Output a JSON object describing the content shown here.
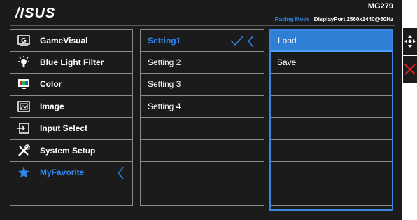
{
  "header": {
    "logo": "ASUS",
    "model": "MG279",
    "mode": "Racing Mode",
    "port_info": "DisplayPort  2560x1440@60Hz"
  },
  "main_menu": [
    {
      "label": "GameVisual",
      "icon": "gamevisual-icon"
    },
    {
      "label": "Blue Light Filter",
      "icon": "bluelight-icon"
    },
    {
      "label": "Color",
      "icon": "color-icon"
    },
    {
      "label": "Image",
      "icon": "image-icon"
    },
    {
      "label": "Input Select",
      "icon": "input-select-icon"
    },
    {
      "label": "System Setup",
      "icon": "system-setup-icon"
    },
    {
      "label": "MyFavorite",
      "icon": "star-icon",
      "active": true
    },
    {
      "label": ""
    }
  ],
  "sub_menu": [
    {
      "label": "Setting1",
      "active": true
    },
    {
      "label": "Setting 2"
    },
    {
      "label": "Setting 3"
    },
    {
      "label": "Setting 4"
    },
    {
      "label": ""
    },
    {
      "label": ""
    },
    {
      "label": ""
    },
    {
      "label": ""
    }
  ],
  "options": [
    {
      "label": "Load",
      "selected": true
    },
    {
      "label": "Save"
    },
    {
      "label": ""
    },
    {
      "label": ""
    },
    {
      "label": ""
    },
    {
      "label": ""
    },
    {
      "label": ""
    },
    {
      "label": ""
    }
  ],
  "colors": {
    "accent": "#2d86e8",
    "background": "#1b1b1b",
    "close": "#e02020"
  }
}
